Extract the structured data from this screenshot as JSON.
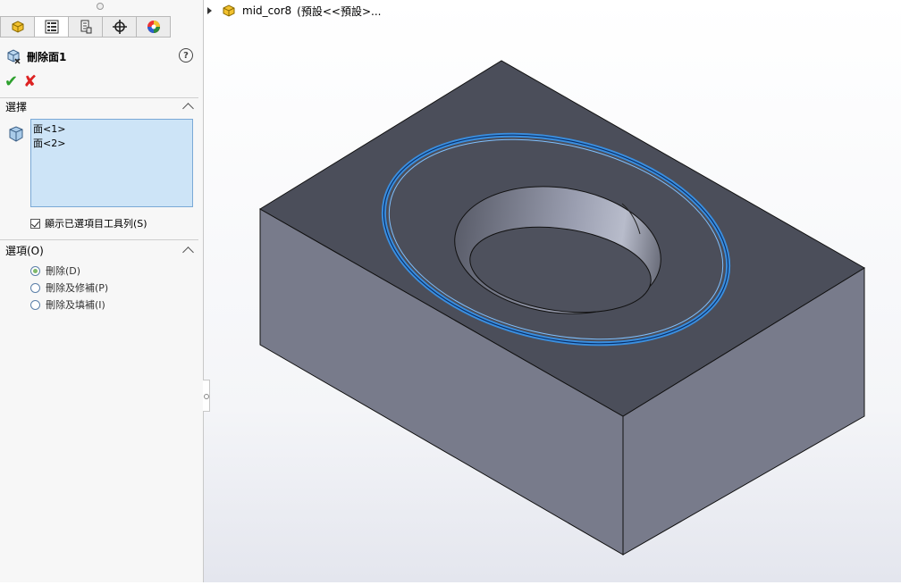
{
  "property_manager": {
    "tabs": [
      {
        "icon": "feature-manager-icon"
      },
      {
        "icon": "property-manager-icon"
      },
      {
        "icon": "configuration-manager-icon"
      },
      {
        "icon": "dimxpert-icon"
      },
      {
        "icon": "display-manager-icon"
      }
    ],
    "title": "刪除面1",
    "help": "?",
    "ok_icon": "check-icon",
    "cancel_icon": "close-icon",
    "selection_group": {
      "title": "選擇",
      "items": [
        "面<1>",
        "面<2>"
      ],
      "show_toolbar_label": "顯示已選項目工具列(S)",
      "show_toolbar_checked": true
    },
    "options_group": {
      "title": "選項(O)",
      "options": [
        {
          "label": "刪除(D)",
          "selected": true
        },
        {
          "label": "刪除及修補(P)",
          "selected": false
        },
        {
          "label": "刪除及填補(I)",
          "selected": false
        }
      ]
    }
  },
  "feature_tree": {
    "label": "mid_cor8",
    "config": "(預設<<預設>..."
  },
  "colors": {
    "top_face": "#4b4e5a",
    "side_face": "#787b8b",
    "highlight": "#3a8fe0"
  }
}
